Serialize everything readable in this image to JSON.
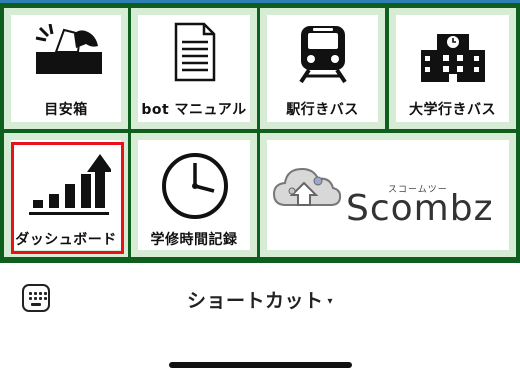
{
  "menu": {
    "tiles": [
      {
        "label": "目安箱",
        "icon": "ballot-box-icon"
      },
      {
        "label": "bot マニュアル",
        "icon": "document-icon"
      },
      {
        "label": "駅行きバス",
        "icon": "train-icon"
      },
      {
        "label": "大学行きバス",
        "icon": "school-building-icon"
      },
      {
        "label": "ダッシュボード",
        "icon": "bar-chart-arrow-icon",
        "selected": true
      },
      {
        "label": "学修時間記録",
        "icon": "clock-icon"
      },
      {
        "label": "",
        "icon": "scombz-logo",
        "logo_text": "Scombz",
        "logo_kana": "スコームツー"
      }
    ]
  },
  "footer": {
    "keyboard_icon": "keyboard-icon",
    "title": "ショートカット",
    "dropdown_icon": "▾"
  },
  "colors": {
    "grid_border": "#0e5e1d",
    "tile_frame": "#d7ecd4",
    "highlight": "#e8101a"
  }
}
